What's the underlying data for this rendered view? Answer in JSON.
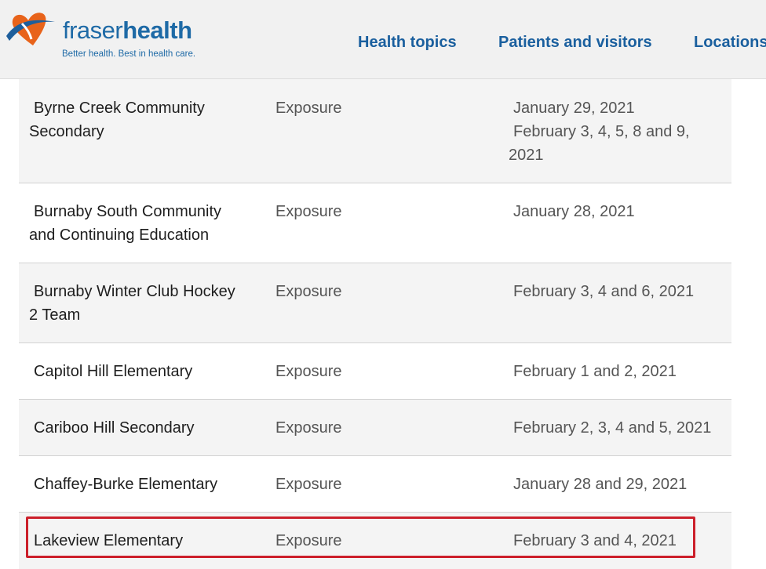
{
  "header": {
    "logo_light": "fraser",
    "logo_bold": "health",
    "tagline": "Better health. Best in health care.",
    "nav": [
      "Health topics",
      "Patients and visitors",
      "Locations"
    ]
  },
  "rows": [
    {
      "name_l1": "Byrne Creek Community",
      "name_l2": "Secondary",
      "type": "Exposure",
      "date_l1": "January 29, 2021",
      "date_l2": "February 3, 4, 5, 8 and 9,",
      "date_l3": "2021"
    },
    {
      "name_l1": "Burnaby South Community",
      "name_l2": "and Continuing Education",
      "type": "Exposure",
      "date_l1": "January 28, 2021"
    },
    {
      "name_l1": "Burnaby Winter Club Hockey",
      "name_l2": "2 Team",
      "type": "Exposure",
      "date_l1": "February 3, 4 and 6, 2021"
    },
    {
      "name_l1": "Capitol Hill Elementary",
      "type": "Exposure",
      "date_l1": "February 1 and 2, 2021"
    },
    {
      "name_l1": "Cariboo Hill Secondary",
      "type": "Exposure",
      "date_l1": "February 2, 3, 4 and 5, 2021"
    },
    {
      "name_l1": "Chaffey-Burke Elementary",
      "type": "Exposure",
      "date_l1": "January 28 and 29, 2021"
    },
    {
      "name_l1": "Lakeview Elementary",
      "type": "Exposure",
      "date_l1": "February 3 and 4, 2021"
    }
  ],
  "colors": {
    "brand_blue": "#1e6aa6",
    "logo_orange": "#e8631a",
    "highlight_red": "#cc1f2a"
  },
  "icons": [
    "fraserhealth-heart-logo"
  ]
}
